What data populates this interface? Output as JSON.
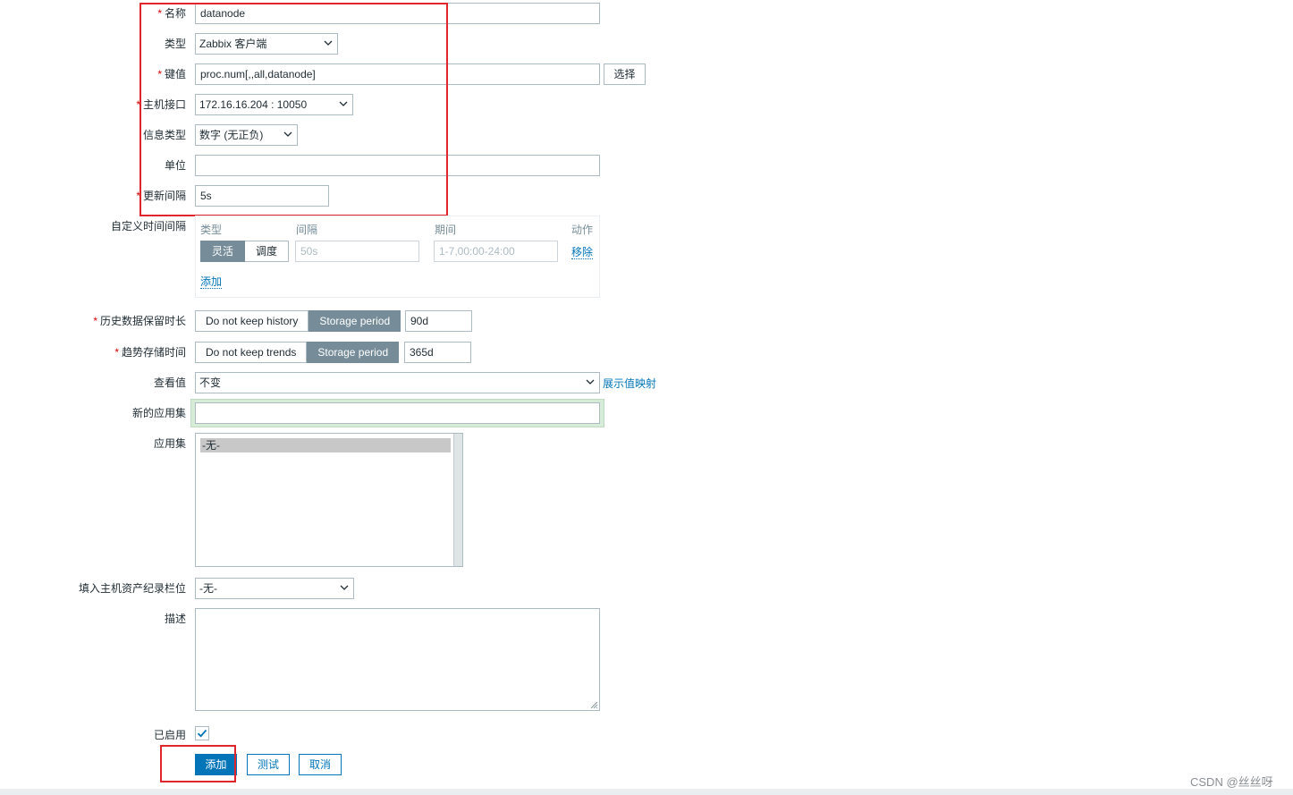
{
  "form": {
    "name": {
      "label": "名称",
      "value": "datanode"
    },
    "type": {
      "label": "类型",
      "value": "Zabbix 客户端"
    },
    "key": {
      "label": "键值",
      "value": "proc.num[,,all,datanode]",
      "select_label": "选择"
    },
    "interface": {
      "label": "主机接口",
      "value": "172.16.16.204 : 10050"
    },
    "info_type": {
      "label": "信息类型",
      "value": "数字 (无正负)"
    },
    "units": {
      "label": "单位",
      "value": ""
    },
    "update_interval": {
      "label": "更新间隔",
      "value": "5s"
    },
    "custom_intervals": {
      "label": "自定义时间间隔",
      "col_type": "类型",
      "col_interval": "间隔",
      "col_period": "期间",
      "col_action": "动作",
      "flexible_label": "灵活",
      "scheduling_label": "调度",
      "interval_placeholder": "50s",
      "period_placeholder": "1-7,00:00-24:00",
      "remove_label": "移除",
      "add_label": "添加"
    },
    "history": {
      "label": "历史数据保留时长",
      "off_label": "Do not keep history",
      "on_label": "Storage period",
      "value": "90d"
    },
    "trends": {
      "label": "趋势存储时间",
      "off_label": "Do not keep trends",
      "on_label": "Storage period",
      "value": "365d"
    },
    "show_value": {
      "label": "查看值",
      "value": "不变",
      "link_label": "展示值映射"
    },
    "new_application": {
      "label": "新的应用集",
      "value": ""
    },
    "applications": {
      "label": "应用集",
      "items": [
        "-无-"
      ]
    },
    "inventory_field": {
      "label": "填入主机资产纪录栏位",
      "value": "-无-"
    },
    "description": {
      "label": "描述",
      "value": ""
    },
    "enabled": {
      "label": "已启用",
      "checked": true
    }
  },
  "buttons": {
    "add": "添加",
    "test": "测试",
    "cancel": "取消"
  },
  "watermark": "CSDN @丝丝呀",
  "colors": {
    "primary": "#0275b8",
    "annotation": "#e0262c",
    "segment_active": "#768d99",
    "required": "#d40000"
  }
}
